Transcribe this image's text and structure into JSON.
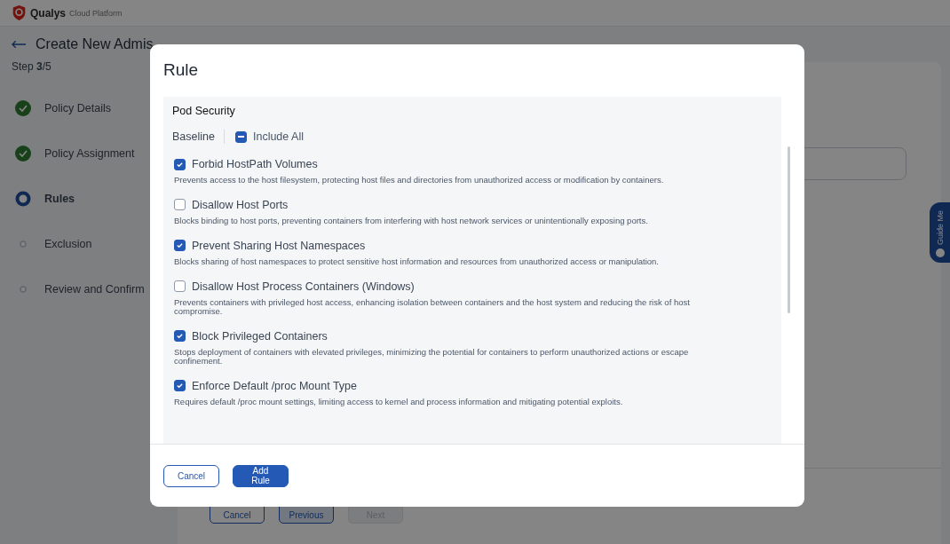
{
  "app": {
    "brand": "Qualys",
    "product": "Cloud Platform"
  },
  "page": {
    "title": "Create New Admis",
    "step": "Step **3**/5",
    "steps": [
      {
        "label": "Policy Details",
        "kind": "done"
      },
      {
        "label": "Policy Assignment",
        "kind": "done"
      },
      {
        "label": "Rules",
        "kind": "current"
      },
      {
        "label": "Exclusion",
        "kind": "pending"
      },
      {
        "label": "Review and Confirm",
        "kind": "pending"
      }
    ],
    "buttons": [
      {
        "label": "Cancel",
        "kind": "outline",
        "disabled": false
      },
      {
        "label": "Previous",
        "kind": "secondary",
        "disabled": false
      },
      {
        "label": "Next",
        "kind": "secondary",
        "disabled": true
      }
    ],
    "guide": "Guide Me"
  },
  "modal": {
    "title": "Rule",
    "section": "Pod Security",
    "group": "Baseline",
    "include_all": {
      "label": "Include All",
      "indeterminate": true
    },
    "rules": [
      {
        "title": "Forbid HostPath Volumes",
        "checked": true,
        "description": "Prevents access to the host filesystem, protecting host files and directories from unauthorized access or modification by containers."
      },
      {
        "title": "Disallow Host Ports",
        "checked": false,
        "description": "Blocks binding to host ports, preventing containers from interfering with host network services or unintentionally exposing ports."
      },
      {
        "title": "Prevent Sharing Host Namespaces",
        "checked": true,
        "description": "Blocks sharing of host namespaces to protect sensitive host information and resources from unauthorized access or manipulation."
      },
      {
        "title": "Disallow Host Process Containers (Windows)",
        "checked": false,
        "description": "Prevents containers with privileged host access, enhancing isolation between containers and the host system and reducing the risk of host compromise."
      },
      {
        "title": "Block Privileged Containers",
        "checked": true,
        "description": "Stops deployment of containers with elevated privileges, minimizing the potential for containers to perform unauthorized actions or escape confinement."
      },
      {
        "title": "Enforce Default /proc Mount Type",
        "checked": true,
        "description": "Requires default /proc mount settings, limiting access to kernel and process information and mitigating potential exploits."
      }
    ],
    "buttons": [
      {
        "label": "Cancel",
        "kind": "outline"
      },
      {
        "label": "Add Rule",
        "kind": "primary"
      }
    ]
  }
}
